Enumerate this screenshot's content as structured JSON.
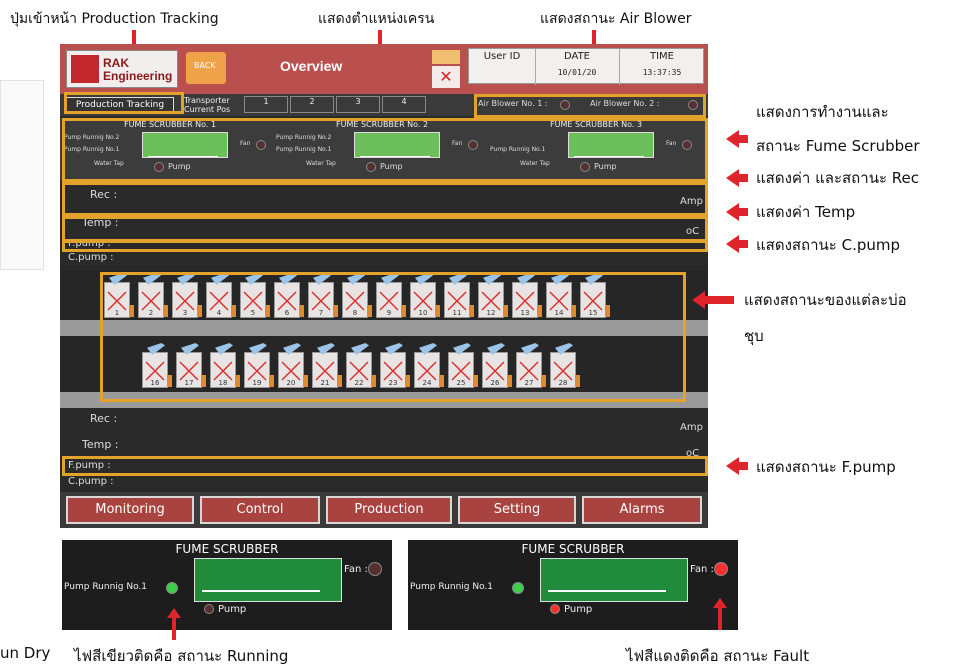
{
  "callouts": {
    "production_tracking": "ปุ่มเข้าหน้า Production Tracking",
    "crane_position": "แสดงตำแหน่งเครน",
    "air_blower": "แสดงสถานะ Air Blower",
    "fume_scrubber_line1": "แสดงการทำงานและ",
    "fume_scrubber_line2": "สถานะ Fume Scrubber",
    "rec": "แสดงค่า และสถานะ Rec",
    "temp": "แสดงค่า Temp",
    "cpump": "แสดงสถานะ C.pump",
    "tank_line1": "แสดงสถานะของแต่ละบ่อ",
    "tank_line2": "ชุบ",
    "fpump": "แสดงสถานะ F.pump",
    "run_dry": "un Dry",
    "green_running": "ไฟสีเขียวติดคือ สถานะ Running",
    "red_fault": "ไฟสีแดงติดคือ สถานะ Fault"
  },
  "header": {
    "logo_text_1": "RAK",
    "logo_text_2": "Engineering",
    "back_label": "BACK",
    "title": "Overview",
    "user_id_label": "User ID",
    "date_label": "DATE",
    "time_label": "TIME",
    "date_value": "10/01/20",
    "time_value": "13:37:35"
  },
  "row2": {
    "production_tracking": "Production Tracking",
    "transporter": "Transporter",
    "current_pos": "Current Pos",
    "transporters": [
      "1",
      "2",
      "3",
      "4"
    ],
    "blower1": "Air Blower No. 1 :",
    "blower2": "Air Blower No. 2 :"
  },
  "fume": {
    "units": [
      {
        "title": "FUME SCRUBBER No. 1",
        "pump_a": "Pump Runnig No.2",
        "pump_b": "Pump Runnig No.1",
        "water": "Water Tap",
        "fan": "Fan",
        "pump": "Pump"
      },
      {
        "title": "FUME SCRUBBER No. 2",
        "pump_a": "Pump Runnig No.2",
        "pump_b": "Pump Runnig No.1",
        "water": "Water Tap",
        "fan": "Fan",
        "pump": "Pump"
      },
      {
        "title": "FUME SCRUBBER No. 3",
        "pump_a": "",
        "pump_b": "Pump Runnig No.1",
        "water": "Water Tap",
        "fan": "Fan",
        "pump": "Pump"
      }
    ]
  },
  "rows": {
    "rec": "Rec :",
    "temp": "Temp :",
    "fpump": "F.pump :",
    "cpump": "C.pump :",
    "amp": "Amp",
    "oc": "oC"
  },
  "tanks": {
    "top": [
      "1",
      "2",
      "3",
      "4",
      "5",
      "6",
      "7",
      "8",
      "9",
      "10",
      "11",
      "12",
      "13",
      "14",
      "15"
    ],
    "bottom": [
      "16",
      "17",
      "18",
      "19",
      "20",
      "21",
      "22",
      "23",
      "24",
      "25",
      "26",
      "27",
      "28"
    ]
  },
  "nav": {
    "monitoring": "Monitoring",
    "control": "Control",
    "production": "Production",
    "setting": "Setting",
    "alarms": "Alarms"
  },
  "panels": {
    "title": "FUME SCRUBBER",
    "pump_running": "Pump Runnig No.1",
    "fan": "Fan :",
    "pump": "Pump"
  },
  "colors": {
    "accent_red": "#e0242b",
    "highlight": "#e3a22a",
    "header": "#b9504d",
    "running_green": "#3ccf4a",
    "fault_red": "#ff3030"
  }
}
